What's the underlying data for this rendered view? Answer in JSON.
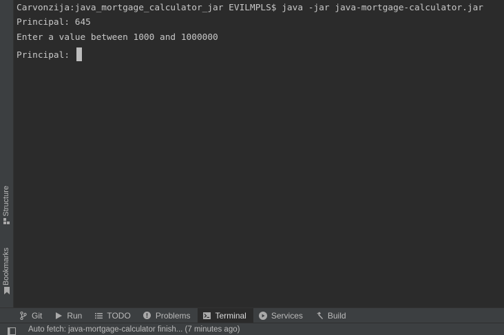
{
  "left_strip": {
    "structure_label": "Structure",
    "bookmarks_label": "Bookmarks"
  },
  "terminal": {
    "lines": [
      "Carvonzija:java_mortgage_calculator_jar EVILMPLS$ java -jar java-mortgage-calculator.jar",
      "Principal: 645",
      "Enter a value between 1000 and 1000000",
      "Principal: "
    ]
  },
  "tool_tabs": [
    {
      "label": "Git",
      "icon": "git-branch-icon"
    },
    {
      "label": "Run",
      "icon": "run-icon"
    },
    {
      "label": "TODO",
      "icon": "todo-list-icon"
    },
    {
      "label": "Problems",
      "icon": "problems-icon"
    },
    {
      "label": "Terminal",
      "icon": "terminal-icon",
      "active": true
    },
    {
      "label": "Services",
      "icon": "services-icon"
    },
    {
      "label": "Build",
      "icon": "hammer-icon"
    }
  ],
  "status_bar": {
    "message": "Auto fetch: java-mortgage-calculator finish... (7 minutes ago)"
  },
  "colors": {
    "background": "#2b2b2b",
    "panel": "#3c3f41",
    "text": "#bbbbbb",
    "terminal_text": "#c8c8c8"
  }
}
